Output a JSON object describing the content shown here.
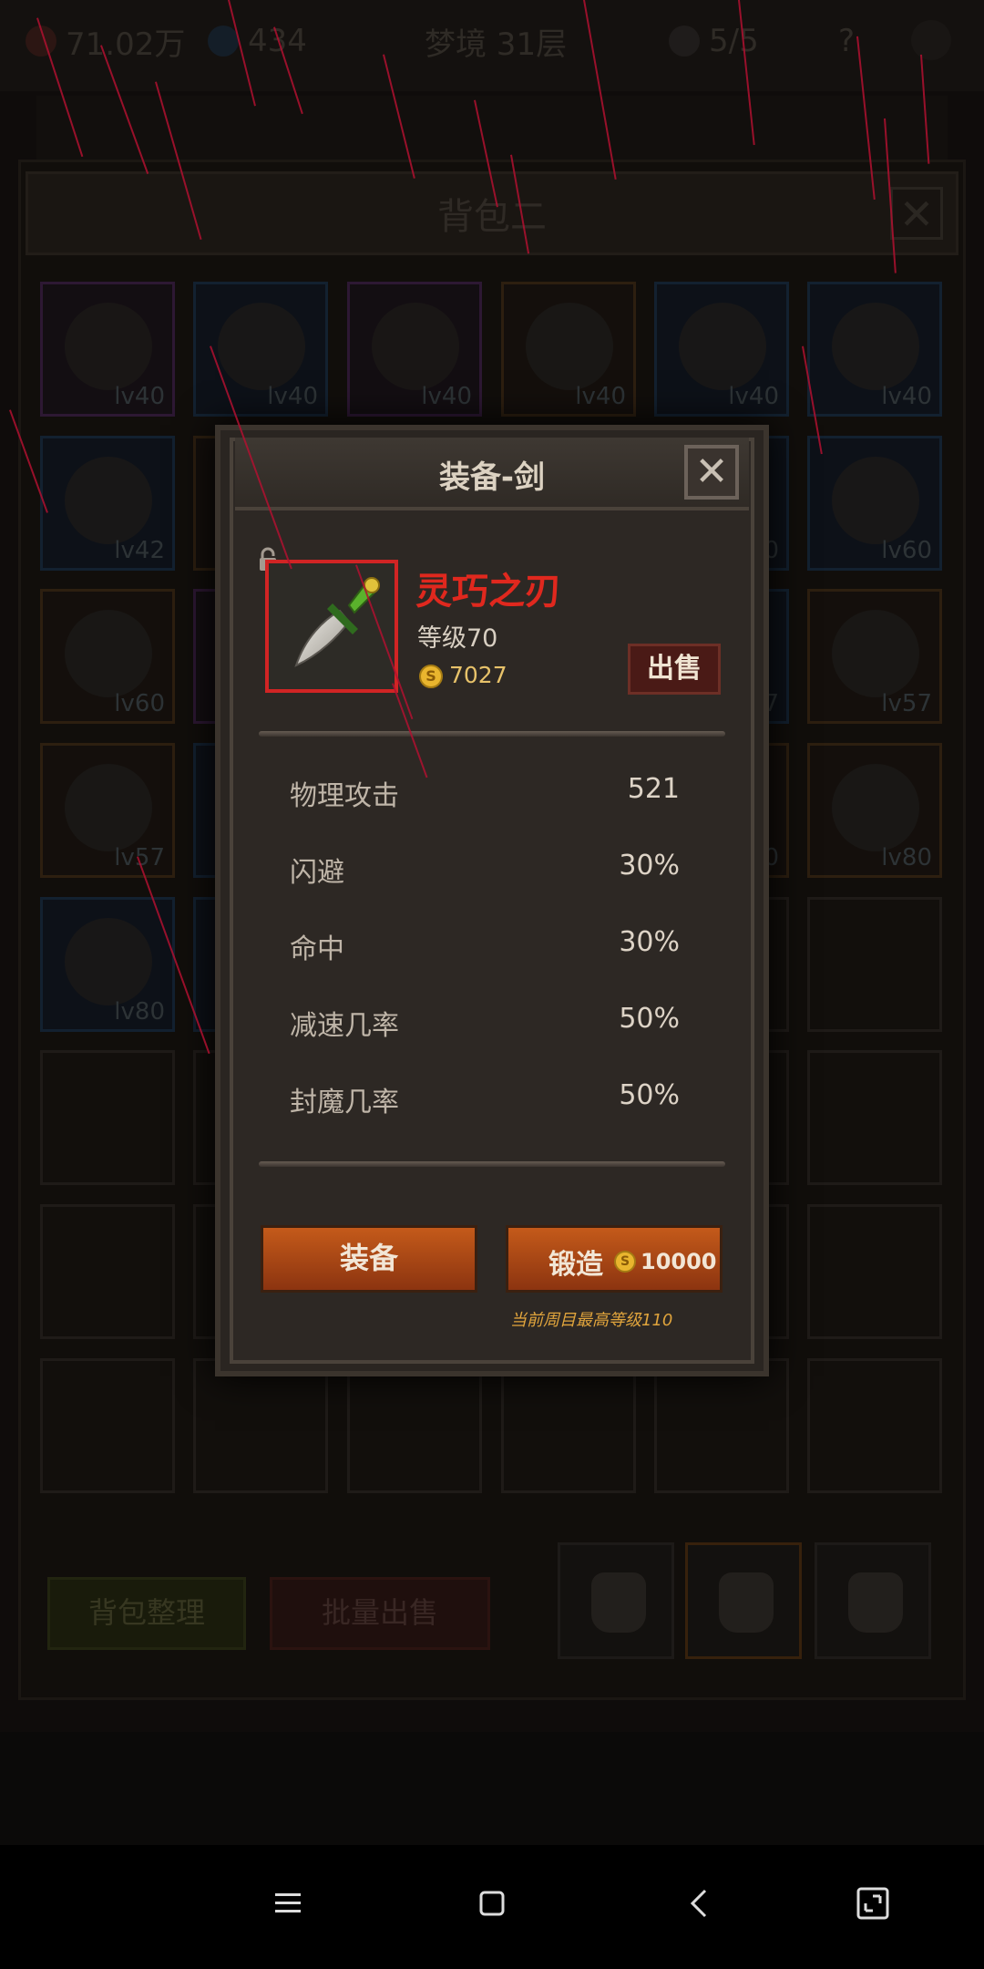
{
  "status": {
    "gold": "71.02万",
    "gems": "434",
    "stage": "梦境 31层",
    "skulls": "5/5",
    "help": "?"
  },
  "bag": {
    "title": "背包二",
    "close": "✕",
    "items": [
      {
        "lv": "lv40",
        "quality": "purple",
        "icon": "orb-icon"
      },
      {
        "lv": "lv40",
        "quality": "blue",
        "icon": "gauntlet-icon"
      },
      {
        "lv": "lv40",
        "quality": "purple",
        "icon": "helmet-icon"
      },
      {
        "lv": "lv40",
        "quality": "orange",
        "icon": "spear-icon"
      },
      {
        "lv": "lv40",
        "quality": "blue",
        "icon": "ring-icon"
      },
      {
        "lv": "lv40",
        "quality": "blue",
        "icon": "spear-icon"
      },
      {
        "lv": "lv42",
        "quality": "blue",
        "icon": "orb-icon"
      },
      {
        "lv": "",
        "quality": "orange",
        "icon": "armor-icon"
      },
      {
        "lv": "",
        "quality": "blue",
        "icon": "armor-icon"
      },
      {
        "lv": "",
        "quality": "blue",
        "icon": "armor-icon"
      },
      {
        "lv": "0",
        "quality": "blue",
        "icon": "armor-icon"
      },
      {
        "lv": "lv60",
        "quality": "blue",
        "icon": "armor-icon"
      },
      {
        "lv": "lv60",
        "quality": "orange",
        "icon": "whip-icon"
      },
      {
        "lv": "",
        "quality": "purple",
        "icon": "armor-icon"
      },
      {
        "lv": "",
        "quality": "blue",
        "icon": "armor-icon"
      },
      {
        "lv": "",
        "quality": "blue",
        "icon": "armor-icon"
      },
      {
        "lv": "7",
        "quality": "blue",
        "icon": "armor-icon"
      },
      {
        "lv": "lv57",
        "quality": "orange",
        "icon": "helmet-icon"
      },
      {
        "lv": "lv57",
        "quality": "orange",
        "icon": "shoulder-icon"
      },
      {
        "lv": "",
        "quality": "blue",
        "icon": "armor-icon"
      },
      {
        "lv": "",
        "quality": "blue",
        "icon": "armor-icon"
      },
      {
        "lv": "",
        "quality": "blue",
        "icon": "armor-icon"
      },
      {
        "lv": "0",
        "quality": "orange",
        "icon": "armor-icon"
      },
      {
        "lv": "lv80",
        "quality": "orange",
        "icon": "ring-icon"
      },
      {
        "lv": "lv80",
        "quality": "blue",
        "icon": "mace-icon"
      },
      {
        "lv": "",
        "quality": "blue",
        "icon": "mace-icon"
      }
    ],
    "sort_label": "背包整理",
    "batch_sell_label": "批量出售"
  },
  "modal": {
    "title": "装备-剑",
    "close": "✕",
    "item_name": "灵巧之刃",
    "item_level": "等级70",
    "item_price": "7027",
    "sell_label": "出售",
    "stats": [
      {
        "name": "物理攻击",
        "value": "521"
      },
      {
        "name": "闪避",
        "value": "30%"
      },
      {
        "name": "命中",
        "value": "30%"
      },
      {
        "name": "减速几率",
        "value": "50%"
      },
      {
        "name": "封魔几率",
        "value": "50%"
      }
    ],
    "equip_label": "装备",
    "forge_label": "锻造",
    "forge_cost": "10000",
    "max_level_note": "当前周目最高等级110",
    "coin_glyph": "S"
  },
  "colors": {
    "item_name": "#e0281e",
    "button": "#b24a16",
    "rarity_frame": "#d12424"
  }
}
